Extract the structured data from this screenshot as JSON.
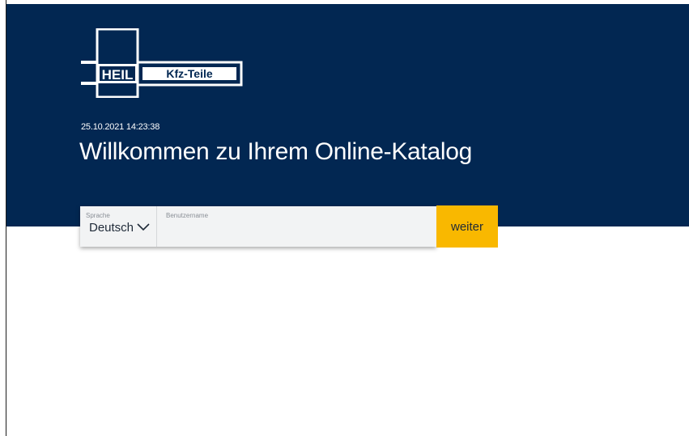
{
  "brand": {
    "logo_main": "HEIL",
    "logo_sub": "Kfz-Teile",
    "navy": "#022752",
    "accent": "#f9b800"
  },
  "header": {
    "timestamp": "25.10.2021 14:23:38",
    "headline": "Willkommen zu Ihrem Online-Katalog"
  },
  "login": {
    "language_label": "Sprache",
    "language_value": "Deutsch",
    "language_icon": "chevron-down-icon",
    "username_label": "Benutzername",
    "username_value": "",
    "submit_label": "weiter"
  }
}
